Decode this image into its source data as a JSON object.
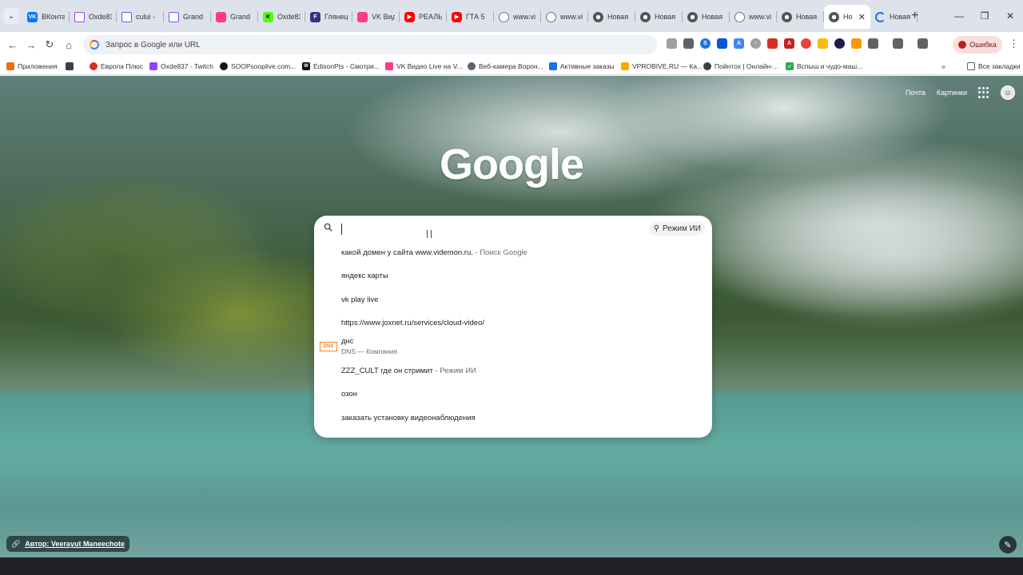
{
  "tabs": [
    {
      "title": "ВКонта",
      "favicon": "vk-icon",
      "active": false
    },
    {
      "title": "Oxde83",
      "favicon": "twitch-icon",
      "active": false
    },
    {
      "title": "cului -",
      "favicon": "twitch-icon",
      "active": false
    },
    {
      "title": "Grand",
      "favicon": "twitch-icon",
      "active": false
    },
    {
      "title": "Grand",
      "favicon": "vk-video-icon",
      "active": false
    },
    {
      "title": "Oxde83",
      "favicon": "kick-icon",
      "active": false
    },
    {
      "title": "Глянец",
      "favicon": "fbox-icon",
      "active": false
    },
    {
      "title": "VK Вид",
      "favicon": "vk-video-icon",
      "active": false
    },
    {
      "title": "РЕАЛЬ",
      "favicon": "youtube-icon",
      "active": false
    },
    {
      "title": "ГТА 5",
      "favicon": "youtube-icon",
      "active": false
    },
    {
      "title": "www.vi",
      "favicon": "globe-icon",
      "active": false
    },
    {
      "title": "www.vi",
      "favicon": "globe-icon",
      "active": false
    },
    {
      "title": "Новая",
      "favicon": "chrome-icon",
      "active": false
    },
    {
      "title": "Новая",
      "favicon": "chrome-icon",
      "active": false
    },
    {
      "title": "Новая",
      "favicon": "chrome-icon",
      "active": false
    },
    {
      "title": "www.vi",
      "favicon": "globe-icon",
      "active": false
    },
    {
      "title": "Новая",
      "favicon": "chrome-icon",
      "active": false
    },
    {
      "title": "Но",
      "favicon": "chrome-icon",
      "active": true
    },
    {
      "title": "Новая",
      "favicon": "loading-icon",
      "active": false
    }
  ],
  "toolbar": {
    "omnibox_placeholder": "Запрос в Google или URL",
    "error_label": "Ошибка"
  },
  "bookmarks": [
    {
      "label": "Приложения",
      "icon": "apps-grid-icon"
    },
    {
      "label": "Европа Плюс",
      "icon": "europa-plus-icon"
    },
    {
      "label": "Oxde837 - Twitch",
      "icon": "twitch-icon"
    },
    {
      "label": "SOOPsooplive.com...",
      "icon": "soop-icon"
    },
    {
      "label": "EdisonPts - Смотри...",
      "icon": "w-icon"
    },
    {
      "label": "VK Видео Live на V...",
      "icon": "vk-video-icon"
    },
    {
      "label": "Веб-камера Ворон...",
      "icon": "webcam-icon"
    },
    {
      "label": "Активные заказы",
      "icon": "orders-icon"
    },
    {
      "label": "VPROBIVE.RU — Ка...",
      "icon": "key-icon"
    },
    {
      "label": "Пойнтох | Онлайн-...",
      "icon": "pointoh-icon"
    },
    {
      "label": "Вспыш и чудо-маш...",
      "icon": "check-icon"
    },
    {
      "label": "Все закладки",
      "icon": "folder-icon"
    }
  ],
  "page": {
    "links": {
      "mail": "Почта",
      "images": "Картинки"
    },
    "logo": "Google",
    "author_label": "Автор: Veerayut Maneechote"
  },
  "search": {
    "value": "",
    "ai_mode_label": "Режим ИИ",
    "suggestions": [
      {
        "text": "какой домен у сайта www.videmon.ru.",
        "sub": " - Поиск Google"
      },
      {
        "text": "яндекс карты",
        "sub": ""
      },
      {
        "text": "vk play live",
        "sub": ""
      },
      {
        "text": "https://www.joxnet.ru/services/cloud-video/",
        "sub": ""
      },
      {
        "text": "днс",
        "sub": "DNS — Компания",
        "logo": "DNS"
      },
      {
        "text": "ZZZ_CULT где он стримит",
        "sub": " - Режим ИИ"
      },
      {
        "text": "озон",
        "sub": ""
      },
      {
        "text": "заказать установку видеонаблюдения",
        "sub": ""
      }
    ]
  },
  "colors": {
    "tabstrip": "#dee3eb",
    "error_pill": "#f9dedc",
    "accent": "#1a73e8"
  }
}
